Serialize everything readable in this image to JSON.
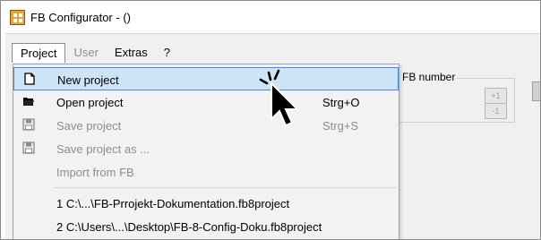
{
  "window": {
    "title": "FB Configurator - ()"
  },
  "menubar": {
    "items": [
      {
        "label": "Project",
        "state": "open"
      },
      {
        "label": "User",
        "state": "disabled"
      },
      {
        "label": "Extras",
        "state": "normal"
      },
      {
        "label": "?",
        "state": "normal"
      }
    ]
  },
  "project_menu": {
    "items": [
      {
        "label": "New project",
        "shortcut": "",
        "icon": "new-file-icon",
        "enabled": true,
        "highlighted": true
      },
      {
        "label": "Open project",
        "shortcut": "Strg+O",
        "icon": "open-folder-icon",
        "enabled": true,
        "highlighted": false
      },
      {
        "label": "Save project",
        "shortcut": "Strg+S",
        "icon": "save-icon",
        "enabled": false,
        "highlighted": false
      },
      {
        "label": "Save project as ...",
        "shortcut": "",
        "icon": "save-as-icon",
        "enabled": false,
        "highlighted": false
      },
      {
        "label": "Import from FB",
        "shortcut": "",
        "icon": "",
        "enabled": false,
        "highlighted": false
      }
    ],
    "recent_files": [
      "1 C:\\...\\FB-Prrojekt-Dokumentation.fb8project",
      "2 C:\\Users\\...\\Desktop\\FB-8-Config-Doku.fb8project"
    ]
  },
  "fb_number_group": {
    "label": "FB number",
    "increment_label": "+1",
    "decrement_label": "-1"
  },
  "colors": {
    "highlight_bg": "#cde4f7",
    "highlight_border": "#3d8ee3",
    "disabled_text": "#8d8d8d"
  }
}
